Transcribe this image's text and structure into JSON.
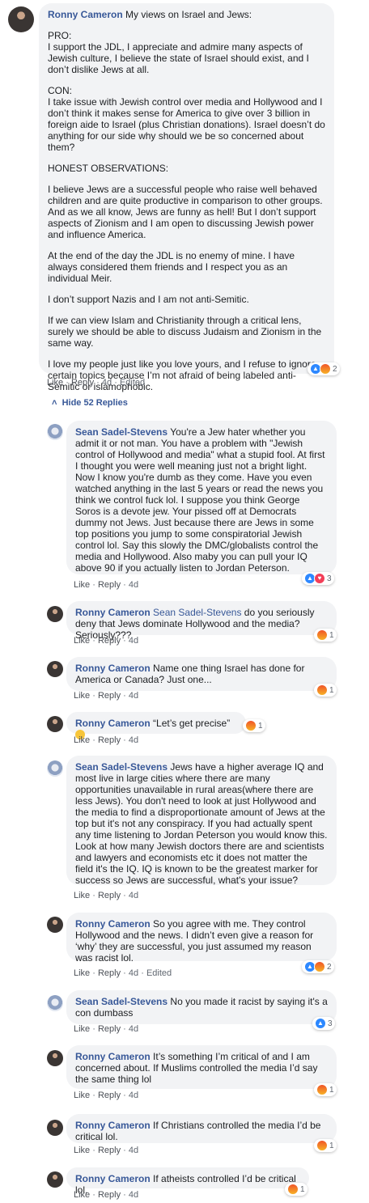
{
  "c0": {
    "name": "Ronny Cameron",
    "lead": "My views on Israel and Jews:",
    "paras": [
      "PRO:\nI support the JDL, I appreciate and admire many aspects of Jewish culture, I believe the state of Israel should exist, and I don’t dislike Jews at all.",
      "CON:\nI take issue with Jewish control over media and Hollywood and I don’t think it makes sense for America to give over 3 billion in foreign aide to Israel (plus Christian donations). Israel doesn’t do anything for our side why should we be so concerned about them?",
      "HONEST OBSERVATIONS:",
      "I believe Jews are a successful people who raise well behaved children and are quite productive in comparison to other groups. And as we all know, Jews are funny as hell! But I don’t support aspects of Zionism and I am open to discussing Jewish power and influence America.",
      "At the end of the day the JDL is no enemy of mine. I have always considered them friends and I respect you as an individual Meir.",
      "I don’t support Nazis and I am not anti-Semitic.",
      "If we can view Islam and Christianity through a critical lens, surely we should be able to discuss Judaism and Zionism in the same way.",
      "I love my people just like you love yours, and I refuse to ignore certain topics because I’m not afraid of being labeled anti-Semitic or islamophobic."
    ],
    "like": "Like",
    "reply": "Reply",
    "time": "4d",
    "edited": "Edited",
    "reactions": "2"
  },
  "hide_replies": "Hide 52 Replies",
  "replies": [
    {
      "name": "Sean Sadel-Stevens",
      "text": "You're a Jew hater whether you admit it or not man. You have a problem with \"Jewish control of Hollywood and media\" what a stupid fool. At first I thought you were well meaning just not a bright light. Now I know you're dumb as they come. Have you even watched anything in the last 5 years or read the news you think we control fuck lol. I suppose you think George Soros is a devote jew. Your pissed off at Democrats dummy not Jews. Just because there are Jews in some top positions you jump to some conspiratorial Jewish control lol. Say this slowly the DMC/globalists control the media and Hollywood. Also maby you can pull your IQ above 90 if you actually listen to Jordan Peterson.",
      "like": "Like",
      "reply": "Reply",
      "time": "4d",
      "reactions": "3"
    },
    {
      "name": "Ronny Cameron",
      "mention": "Sean Sadel-Stevens",
      "text": "do you seriously deny that Jews dominate Hollywood and the media? Seriously???",
      "like": "Like",
      "reply": "Reply",
      "time": "4d",
      "reactions": "1"
    },
    {
      "name": "Ronny Cameron",
      "text": "Name one thing Israel has done for America or Canada? Just one...",
      "like": "Like",
      "reply": "Reply",
      "time": "4d",
      "reactions": "1"
    },
    {
      "name": "Ronny Cameron",
      "text": "“Let’s get precise”",
      "like": "Like",
      "reply": "Reply",
      "time": "4d",
      "reactions": "1"
    },
    {
      "name": "Sean Sadel-Stevens",
      "text": "Jews have a higher average IQ and most live in large cities where there are many opportunities unavailable in rural areas(where there are less Jews). You don't need to look at just Hollywood and the media to find a disproportionate amount of Jews at the top but it's not any conspiracy. If you had actually spent any time listening to Jordan Peterson you would know this. Look at how many Jewish doctors there are and scientists and lawyers and economists etc it does not matter the field it's the IQ. IQ is known to be the greatest marker for success so Jews are successful, what's your issue?",
      "like": "Like",
      "reply": "Reply",
      "time": "4d"
    },
    {
      "name": "Ronny Cameron",
      "text": "So you agree with me. They control Hollywood and the news. I didn’t even give a reason for ‘why’ they are successful, you just assumed my reason was racist lol.",
      "like": "Like",
      "reply": "Reply",
      "time": "4d",
      "edited": "Edited",
      "reactions": "2"
    },
    {
      "name": "Sean Sadel-Stevens",
      "text": "No you made it racist by saying it's a con dumbass",
      "like": "Like",
      "reply": "Reply",
      "time": "4d",
      "reactions": "3"
    },
    {
      "name": "Ronny Cameron",
      "text": "It’s something I’m critical of and I am concerned about. If Muslims controlled the media I’d say the same thing lol",
      "like": "Like",
      "reply": "Reply",
      "time": "4d",
      "reactions": "1"
    },
    {
      "name": "Ronny Cameron",
      "text": "If Christians controlled the media I’d be critical lol.",
      "like": "Like",
      "reply": "Reply",
      "time": "4d",
      "reactions": "1"
    },
    {
      "name": "Ronny Cameron",
      "text": "If atheists controlled I’d be critical lol.",
      "like": "Like",
      "reply": "Reply",
      "time": "4d",
      "reactions": "1"
    }
  ],
  "sep": "·"
}
